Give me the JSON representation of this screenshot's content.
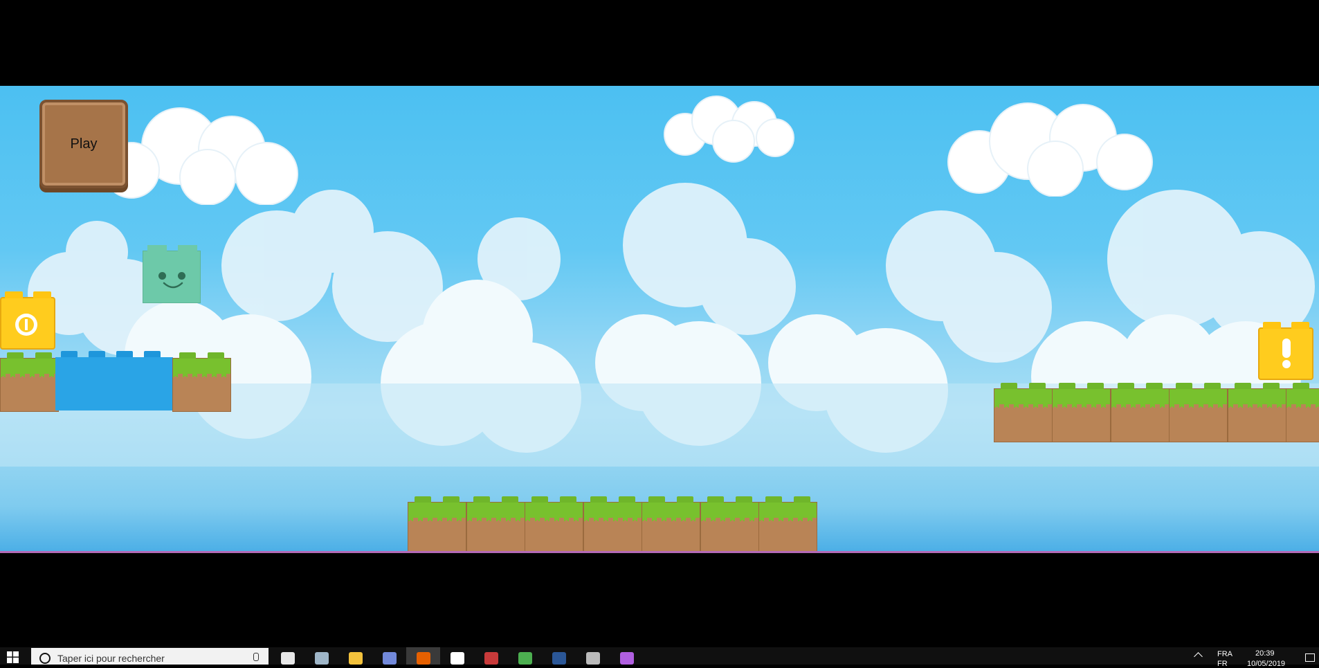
{
  "game": {
    "play_label": "Play"
  },
  "taskbar": {
    "search_placeholder": "Taper ici pour rechercher",
    "apps": [
      {
        "icon": "store-icon",
        "color": "#e8e8e8"
      },
      {
        "icon": "steam-icon",
        "color": "#9fb6c8"
      },
      {
        "icon": "file-explorer-icon",
        "color": "#f3c23c"
      },
      {
        "icon": "discord-icon",
        "color": "#7289da"
      },
      {
        "icon": "firefox-icon",
        "color": "#e66000",
        "active": true
      },
      {
        "icon": "mail-icon",
        "color": "#ffffff"
      },
      {
        "icon": "unity-flag-icon",
        "color": "#c83a3a"
      },
      {
        "icon": "clover-icon",
        "color": "#4caf50"
      },
      {
        "icon": "word-icon",
        "color": "#2b5797"
      },
      {
        "icon": "settings-gear-icon",
        "color": "#bbbbbb"
      },
      {
        "icon": "balloon-icon",
        "color": "#b05fe0"
      }
    ],
    "tray": {
      "language": "FRA",
      "language_sub": "FR",
      "time": "20:39",
      "date": "10/05/2019"
    }
  },
  "colors": {
    "sky_top": "#4cc0f2",
    "grass": "#78c12e",
    "dirt": "#b98456",
    "water": "#2aa4e6",
    "bonus_block": "#ffcc1e",
    "player": "#6dc9a9",
    "play_button": "#a67449"
  }
}
